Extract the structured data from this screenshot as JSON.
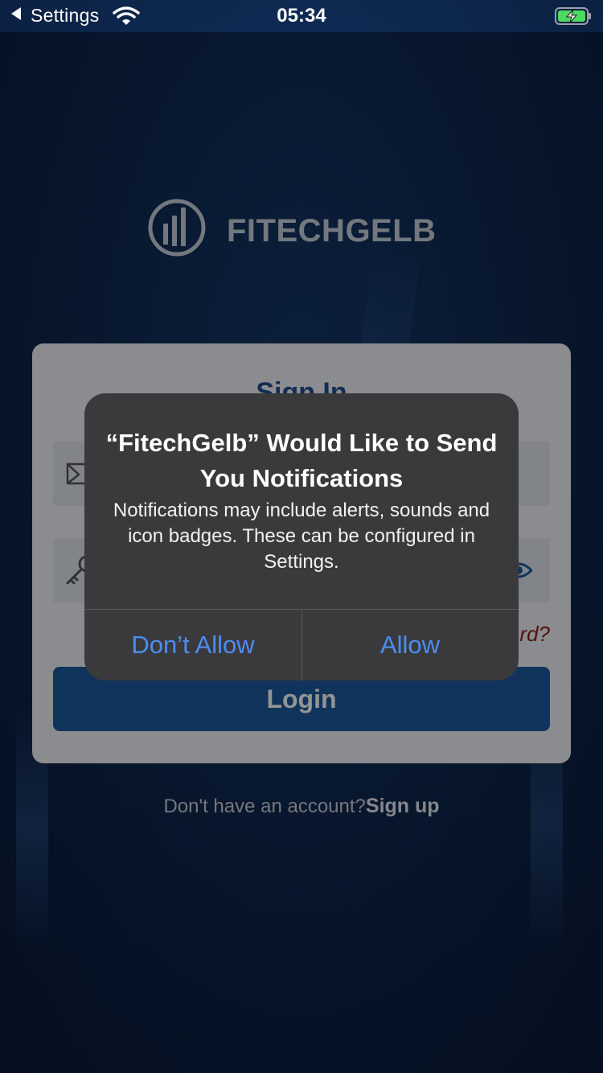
{
  "status_bar": {
    "back_label": "Settings",
    "time": "05:34"
  },
  "logo": {
    "text_light": "FITECH",
    "text_dark": "GELB"
  },
  "signin": {
    "title": "Sign In",
    "forgot_partial": "rd?",
    "login_label": "Login"
  },
  "signup": {
    "prompt": "Don't have an account?",
    "link": "Sign up"
  },
  "alert": {
    "title": "“FitechGelb” Would Like to Send You Notifications",
    "message": "Notifications may include alerts, sounds and icon badges. These can be configured in Settings.",
    "dont_allow_label": "Don’t Allow",
    "allow_label": "Allow"
  },
  "colors": {
    "accent_blue": "#4c8ef2",
    "login_button": "#1d5a9e",
    "alert_background": "#3a3a3c",
    "battery_green": "#4cd964"
  },
  "icons": [
    "back-caret-icon",
    "wifi-icon",
    "battery-charging-icon",
    "logo-mark-icon",
    "email-icon",
    "key-icon",
    "eye-icon"
  ]
}
